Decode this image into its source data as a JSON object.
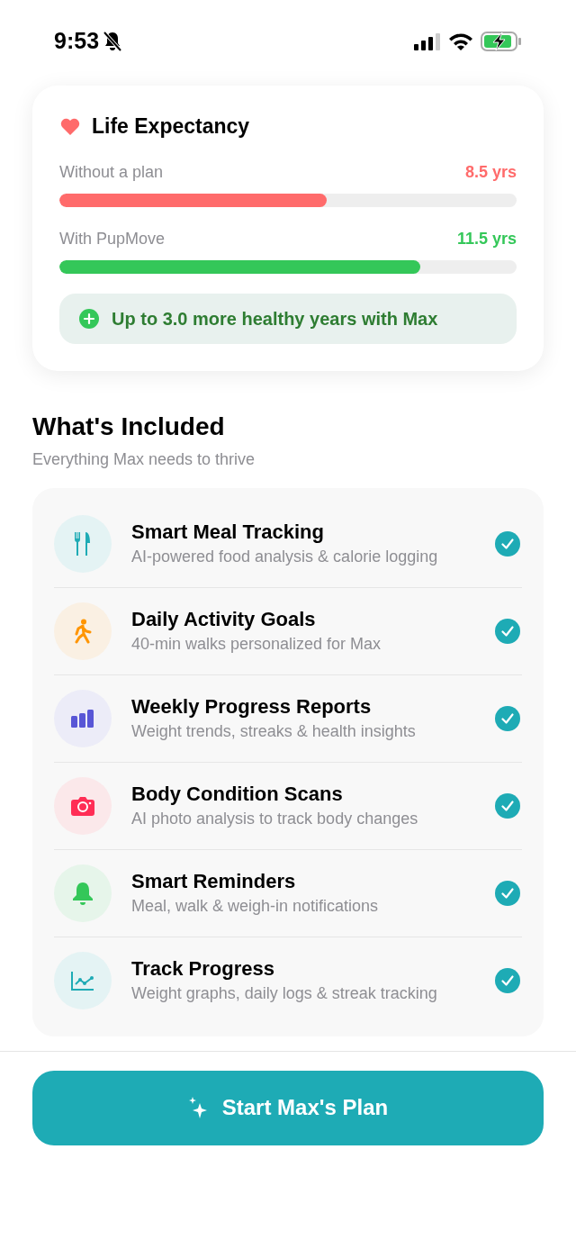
{
  "status_bar": {
    "time": "9:53"
  },
  "life_expectancy": {
    "title": "Life Expectancy",
    "bars": [
      {
        "label": "Without a plan",
        "value": "8.5 yrs",
        "level": 0.585,
        "color": "#ff6b6b"
      },
      {
        "label": "With PupMove",
        "value": "11.5 yrs",
        "level": 0.79,
        "color": "#34c759"
      }
    ],
    "banner": "Up to 3.0 more healthy years with Max"
  },
  "included": {
    "title": "What's Included",
    "subtitle": "Everything Max needs to thrive",
    "items": [
      {
        "kind": "meal",
        "title": "Smart Meal Tracking",
        "description": "AI-powered food analysis & calorie logging",
        "checked": true
      },
      {
        "kind": "activity",
        "title": "Daily Activity Goals",
        "description": "40-min walks personalized for Max",
        "checked": true
      },
      {
        "kind": "reports",
        "title": "Weekly Progress Reports",
        "description": "Weight trends, streaks & health insights",
        "checked": true
      },
      {
        "kind": "scan",
        "title": "Body Condition Scans",
        "description": "AI photo analysis to track body changes",
        "checked": true
      },
      {
        "kind": "reminders",
        "title": "Smart Reminders",
        "description": "Meal, walk & weigh-in notifications",
        "checked": true
      },
      {
        "kind": "progress",
        "title": "Track Progress",
        "description": "Weight graphs, daily logs & streak tracking",
        "checked": true
      }
    ]
  },
  "cta": {
    "label": "Start Max's Plan"
  }
}
